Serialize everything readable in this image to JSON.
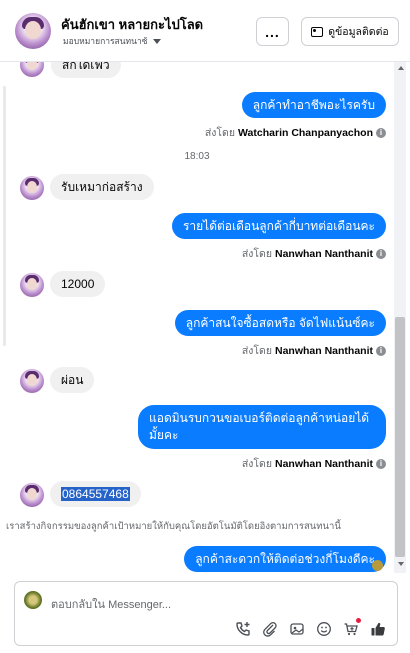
{
  "header": {
    "name": "คันฮักเขา หลายกะไปโลด",
    "assignment": "มอบหมายการสนทนาซ้",
    "more_label": "...",
    "contact_button": "ดูข้อมูลติดต่อ"
  },
  "messages": {
    "m0_partial": "สกใดเฟว",
    "m1_text": "ลูกค้าทำอาชีพอะไรครับ",
    "m1_sent_prefix": "ส่งโดย",
    "m1_sender": "Watcharin Chanpanyachon",
    "time": "18:03",
    "m2_text": "รับเหมาก่อสร้าง",
    "m3_text": "รายได้ต่อเดือนลูกค้ากี่บาทต่อเดือนคะ",
    "m3_sent_prefix": "ส่งโดย",
    "m3_sender": "Nanwhan Nanthanit",
    "m4_text": "12000",
    "m5_text": "ลูกค้าสนใจซื้อสดหรือ จัดไฟแน้นซ์คะ",
    "m5_sent_prefix": "ส่งโดย",
    "m5_sender": "Nanwhan Nanthanit",
    "m6_text": "ผ่อน",
    "m7_text": "แอดมินรบกวนขอเบอร์ติดต่อลูกค้าหน่อยได้มั้ยคะ",
    "m7_sent_prefix": "ส่งโดย",
    "m7_sender": "Nanwhan Nanthanit",
    "m8_text": "0864557468",
    "system_note": "เราสร้างกิจกรรมของลูกค้าเป้าหมายให้กับคุณโดยอัตโนมัติโดยอิงตามการสนทนานี้",
    "m9_text": "ลูกค้าสะดวกให้ติดต่อช่วงกี่โมงดีคะ"
  },
  "composer": {
    "placeholder": "ตอบกลับใน Messenger..."
  },
  "colors": {
    "outgoing_bubble": "#0a7cff",
    "incoming_bubble": "#f0f0f0",
    "selection": "#2563c9"
  },
  "icons": [
    "more-dots-icon",
    "contact-card-icon",
    "info-icon",
    "add-call-icon",
    "attach-icon",
    "media-icon",
    "emoji-icon",
    "cart-icon",
    "thumbs-up-icon"
  ]
}
